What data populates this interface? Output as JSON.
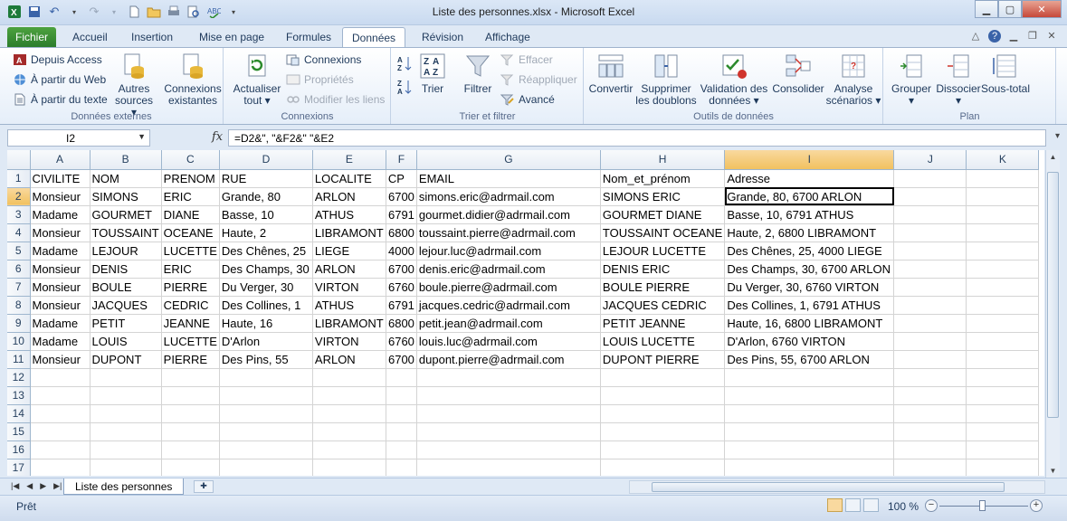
{
  "window": {
    "title": "Liste des personnes.xlsx  -  Microsoft Excel"
  },
  "ribbon": {
    "tabs": [
      "Fichier",
      "Accueil",
      "Insertion",
      "Mise en page",
      "Formules",
      "Données",
      "Révision",
      "Affichage"
    ],
    "active_tab": "Données",
    "groups": {
      "external": {
        "label": "Données externes",
        "depuis_access": "Depuis Access",
        "depuis_web": "À partir du Web",
        "depuis_texte": "À partir du texte",
        "autres_sources": "Autres sources",
        "connexions_existantes": "Connexions existantes"
      },
      "connections": {
        "label": "Connexions",
        "actualiser": "Actualiser tout",
        "connexions": "Connexions",
        "proprietes": "Propriétés",
        "modifier_liens": "Modifier les liens"
      },
      "sort_filter": {
        "label": "Trier et filtrer",
        "trier": "Trier",
        "filtrer": "Filtrer",
        "effacer": "Effacer",
        "reappliquer": "Réappliquer",
        "avance": "Avancé"
      },
      "data_tools": {
        "label": "Outils de données",
        "convertir": "Convertir",
        "supprimer_doublons": "Supprimer les doublons",
        "validation": "Validation des données",
        "consolider": "Consolider",
        "analyse": "Analyse scénarios"
      },
      "outline": {
        "label": "Plan",
        "grouper": "Grouper",
        "dissocier": "Dissocier",
        "sous_total": "Sous-total"
      }
    }
  },
  "formula_bar": {
    "name_box": "I2",
    "formula": "=D2&\", \"&F2&\" \"&E2"
  },
  "sheet": {
    "columns": [
      "A",
      "B",
      "C",
      "D",
      "E",
      "F",
      "G",
      "H",
      "I",
      "J",
      "K"
    ],
    "active_column": "I",
    "active_row": 2,
    "rows": [
      [
        "CIVILITE",
        "NOM",
        "PRENOM",
        "RUE",
        "LOCALITE",
        "CP",
        "EMAIL",
        "Nom_et_prénom",
        "Adresse",
        "",
        ""
      ],
      [
        "Monsieur",
        "SIMONS",
        "ERIC",
        "Grande, 80",
        "ARLON",
        "6700",
        "simons.eric@adrmail.com",
        "SIMONS ERIC",
        "Grande, 80, 6700 ARLON",
        "",
        ""
      ],
      [
        "Madame",
        "GOURMET",
        "DIANE",
        "Basse, 10",
        "ATHUS",
        "6791",
        "gourmet.didier@adrmail.com",
        "GOURMET DIANE",
        "Basse, 10, 6791 ATHUS",
        "",
        ""
      ],
      [
        "Monsieur",
        "TOUSSAINT",
        "OCEANE",
        "Haute, 2",
        "LIBRAMONT",
        "6800",
        "toussaint.pierre@adrmail.com",
        "TOUSSAINT OCEANE",
        "Haute, 2, 6800 LIBRAMONT",
        "",
        ""
      ],
      [
        "Madame",
        "LEJOUR",
        "LUCETTE",
        "Des Chênes, 25",
        "LIEGE",
        "4000",
        "lejour.luc@adrmail.com",
        "LEJOUR LUCETTE",
        "Des Chênes, 25, 4000 LIEGE",
        "",
        ""
      ],
      [
        "Monsieur",
        "DENIS",
        "ERIC",
        "Des Champs, 30",
        "ARLON",
        "6700",
        "denis.eric@adrmail.com",
        "DENIS ERIC",
        "Des Champs, 30, 6700 ARLON",
        "",
        ""
      ],
      [
        "Monsieur",
        "BOULE",
        "PIERRE",
        "Du Verger, 30",
        "VIRTON",
        "6760",
        "boule.pierre@adrmail.com",
        "BOULE PIERRE",
        "Du Verger, 30, 6760 VIRTON",
        "",
        ""
      ],
      [
        "Monsieur",
        "JACQUES",
        "CEDRIC",
        "Des Collines, 1",
        "ATHUS",
        "6791",
        "jacques.cedric@adrmail.com",
        "JACQUES CEDRIC",
        "Des Collines, 1, 6791 ATHUS",
        "",
        ""
      ],
      [
        "Madame",
        "PETIT",
        "JEANNE",
        "Haute, 16",
        "LIBRAMONT",
        "6800",
        "petit.jean@adrmail.com",
        "PETIT JEANNE",
        "Haute, 16, 6800 LIBRAMONT",
        "",
        ""
      ],
      [
        "Madame",
        "LOUIS",
        "LUCETTE",
        "D'Arlon",
        "VIRTON",
        "6760",
        "louis.luc@adrmail.com",
        "LOUIS LUCETTE",
        "D'Arlon, 6760 VIRTON",
        "",
        ""
      ],
      [
        "Monsieur",
        "DUPONT",
        "PIERRE",
        "Des Pins, 55",
        "ARLON",
        "6700",
        "dupont.pierre@adrmail.com",
        "DUPONT PIERRE",
        "Des Pins, 55, 6700 ARLON",
        "",
        ""
      ],
      [
        "",
        "",
        "",
        "",
        "",
        "",
        "",
        "",
        "",
        "",
        ""
      ],
      [
        "",
        "",
        "",
        "",
        "",
        "",
        "",
        "",
        "",
        "",
        ""
      ],
      [
        "",
        "",
        "",
        "",
        "",
        "",
        "",
        "",
        "",
        "",
        ""
      ],
      [
        "",
        "",
        "",
        "",
        "",
        "",
        "",
        "",
        "",
        "",
        ""
      ],
      [
        "",
        "",
        "",
        "",
        "",
        "",
        "",
        "",
        "",
        "",
        ""
      ],
      [
        "",
        "",
        "",
        "",
        "",
        "",
        "",
        "",
        "",
        "",
        ""
      ]
    ],
    "tab_name": "Liste des personnes"
  },
  "status": {
    "ready": "Prêt",
    "zoom": "100 %"
  },
  "colors": {
    "accent": "#2c7d2c",
    "selection": "#f1c15f"
  }
}
